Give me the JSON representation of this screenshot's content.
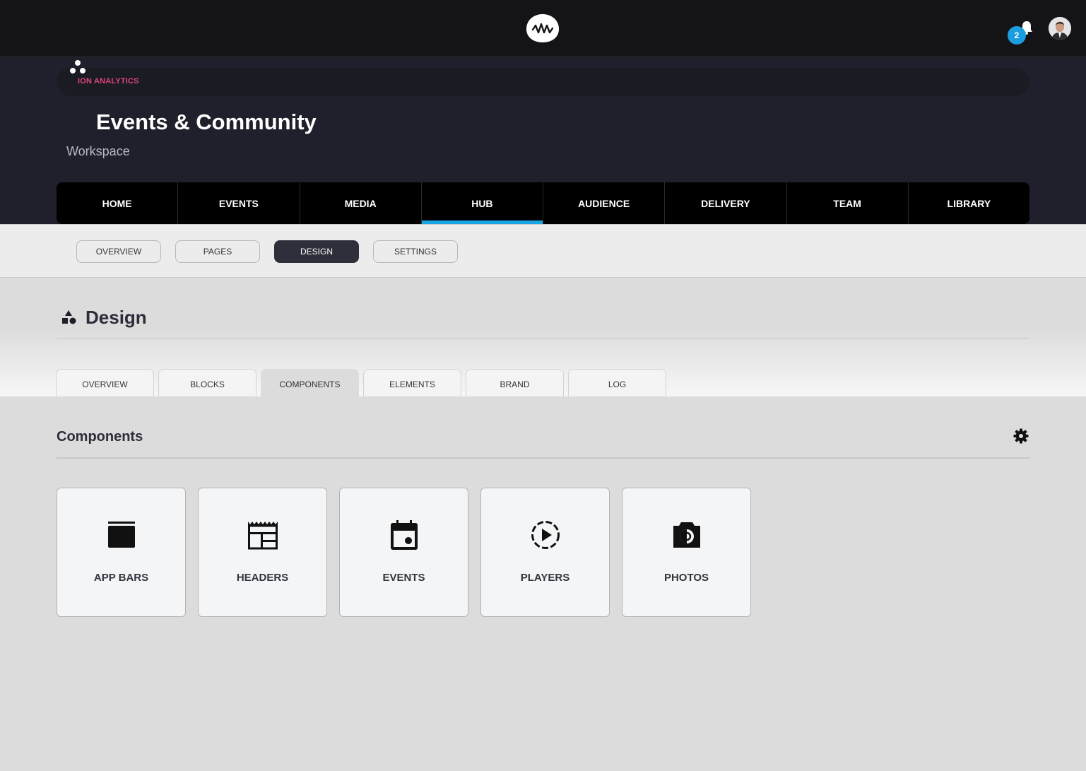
{
  "topbar": {
    "logo_icon": "waveform-logo-icon",
    "notifications": {
      "icon": "bell-icon",
      "count": "2"
    },
    "avatar_icon": "user-avatar"
  },
  "workspace": {
    "breadcrumb": "ION ANALYTICS",
    "title": "Events & Community",
    "subtitle": "Workspace",
    "icon": "community-dots-icon"
  },
  "main_nav": {
    "items": [
      {
        "label": "HOME"
      },
      {
        "label": "EVENTS"
      },
      {
        "label": "MEDIA"
      },
      {
        "label": "HUB",
        "active": true
      },
      {
        "label": "AUDIENCE"
      },
      {
        "label": "DELIVERY"
      },
      {
        "label": "TEAM"
      },
      {
        "label": "LIBRARY"
      }
    ]
  },
  "sub_nav": {
    "items": [
      {
        "label": "OVERVIEW"
      },
      {
        "label": "PAGES"
      },
      {
        "label": "DESIGN",
        "active": true
      },
      {
        "label": "SETTINGS"
      }
    ]
  },
  "design": {
    "title": "Design",
    "icon": "shapes-icon",
    "tabs": [
      {
        "label": "OVERVIEW"
      },
      {
        "label": "BLOCKS"
      },
      {
        "label": "COMPONENTS",
        "active": true
      },
      {
        "label": "ELEMENTS"
      },
      {
        "label": "BRAND"
      },
      {
        "label": "LOG"
      }
    ]
  },
  "components": {
    "title": "Components",
    "settings_icon": "gear-icon",
    "cards": [
      {
        "label": "APP BARS",
        "icon": "app-bar-icon"
      },
      {
        "label": "HEADERS",
        "icon": "header-layout-icon"
      },
      {
        "label": "EVENTS",
        "icon": "calendar-icon"
      },
      {
        "label": "PLAYERS",
        "icon": "play-circle-icon"
      },
      {
        "label": "PHOTOS",
        "icon": "camera-icon"
      }
    ]
  },
  "colors": {
    "accent_blue": "#1aa4e6",
    "breadcrumb_pink": "#e0457a",
    "header_bg": "#1f202b",
    "topbar_bg": "#141416"
  }
}
